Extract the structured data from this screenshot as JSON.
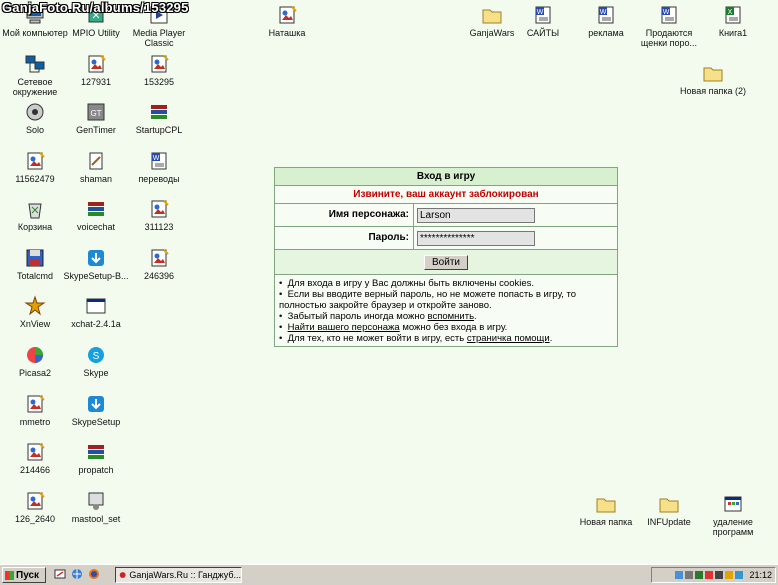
{
  "watermark": "GanjaFoto.Ru/albums/153295",
  "desktop_icons": [
    {
      "id": "my-computer",
      "label": "Мой компьютер",
      "icon": "computer-icon"
    },
    {
      "id": "network",
      "label": "Сетевое окружение",
      "icon": "network-icon"
    },
    {
      "id": "solo",
      "label": "Solo",
      "icon": "speaker-icon"
    },
    {
      "id": "11562479",
      "label": "11562479",
      "icon": "image-file-icon"
    },
    {
      "id": "recycle",
      "label": "Корзина",
      "icon": "recycle-bin-icon"
    },
    {
      "id": "totalcmd",
      "label": "Totalcmd",
      "icon": "floppy-icon"
    },
    {
      "id": "xnview",
      "label": "XnView",
      "icon": "xnview-icon"
    },
    {
      "id": "picasa2",
      "label": "Picasa2",
      "icon": "picasa-icon"
    },
    {
      "id": "mmetro",
      "label": "mmetro",
      "icon": "image-file-icon"
    },
    {
      "id": "214466",
      "label": "214466",
      "icon": "image-file-icon"
    },
    {
      "id": "126_2640",
      "label": "126_2640",
      "icon": "image-file-icon"
    },
    {
      "id": "mpio",
      "label": "MPIO Utility",
      "icon": "mpio-icon"
    },
    {
      "id": "127931",
      "label": "127931",
      "icon": "image-file-icon"
    },
    {
      "id": "gentimer",
      "label": "GenTimer",
      "icon": "timer-icon"
    },
    {
      "id": "shaman",
      "label": "shaman",
      "icon": "note-file-icon"
    },
    {
      "id": "voicechat",
      "label": "voicechat",
      "icon": "archive-icon"
    },
    {
      "id": "skypesetup-b",
      "label": "SkypeSetup-B...",
      "icon": "installer-icon"
    },
    {
      "id": "xchat",
      "label": "xchat-2.4.1a",
      "icon": "window-icon"
    },
    {
      "id": "skype",
      "label": "Skype",
      "icon": "skype-icon"
    },
    {
      "id": "skypesetup",
      "label": "SkypeSetup",
      "icon": "installer-icon"
    },
    {
      "id": "propatch",
      "label": "propatch",
      "icon": "archive-icon"
    },
    {
      "id": "mastool",
      "label": "mastool_set",
      "icon": "setup-icon"
    },
    {
      "id": "mpc",
      "label": "Media Player Classic",
      "icon": "media-player-icon"
    },
    {
      "id": "153295",
      "label": "153295",
      "icon": "image-file-icon"
    },
    {
      "id": "startupcpl",
      "label": "StartupCPL",
      "icon": "archive-icon"
    },
    {
      "id": "perevody",
      "label": "переводы",
      "icon": "word-doc-icon"
    },
    {
      "id": "311123",
      "label": "311123",
      "icon": "image-file-icon"
    },
    {
      "id": "246396",
      "label": "246396",
      "icon": "image-file-icon"
    },
    {
      "id": "natashka",
      "label": "Наташка",
      "icon": "image-file-icon"
    },
    {
      "id": "ganjawars",
      "label": "GanjaWars",
      "icon": "folder-icon"
    },
    {
      "id": "saity",
      "label": "САЙТЫ",
      "icon": "word-doc-icon"
    },
    {
      "id": "reklama",
      "label": "реклама",
      "icon": "word-doc-icon"
    },
    {
      "id": "prodayutsya",
      "label": "Продаются щенки поро...",
      "icon": "word-doc-icon"
    },
    {
      "id": "kniga1",
      "label": "Книга1",
      "icon": "excel-doc-icon"
    },
    {
      "id": "new-folder-2",
      "label": "Новая папка (2)",
      "icon": "folder-icon"
    },
    {
      "id": "new-folder",
      "label": "Новая папка",
      "icon": "folder-icon"
    },
    {
      "id": "infupdate",
      "label": "INFUpdate",
      "icon": "folder-icon"
    },
    {
      "id": "uninstall",
      "label": "удаление программ",
      "icon": "control-panel-icon"
    }
  ],
  "login": {
    "title": "Вход в игру",
    "error": "Извините, ваш аккаунт заблокирован",
    "name_label": "Имя персонажа:",
    "name_value": "Larson",
    "password_label": "Пароль:",
    "password_value": "**************",
    "submit_label": "Войти",
    "info": [
      {
        "text": "Для входа в игру у Вас должны быть включены cookies."
      },
      {
        "text": "Если вы вводите верный пароль, но не можете попасть в игру, то полностью закройте браузер и откройте заново."
      },
      {
        "pre": "Забытый пароль иногда можно ",
        "link": "вспомнить",
        "post": "."
      },
      {
        "pre": "",
        "link": "Найти вашего персонажа",
        "post": " можно без входа в игру."
      },
      {
        "pre": "Для тех, кто не может войти в игру, есть ",
        "link": "страничка помощи",
        "post": "."
      }
    ]
  },
  "taskbar": {
    "start_label": "Пуск",
    "task_label": "GanjaWars.Ru :: Ганджуб...",
    "clock": "21:12"
  },
  "colors": {
    "desktop": "#f3fbef",
    "panel_header": "#d7f0cf",
    "error": "#c00000"
  }
}
